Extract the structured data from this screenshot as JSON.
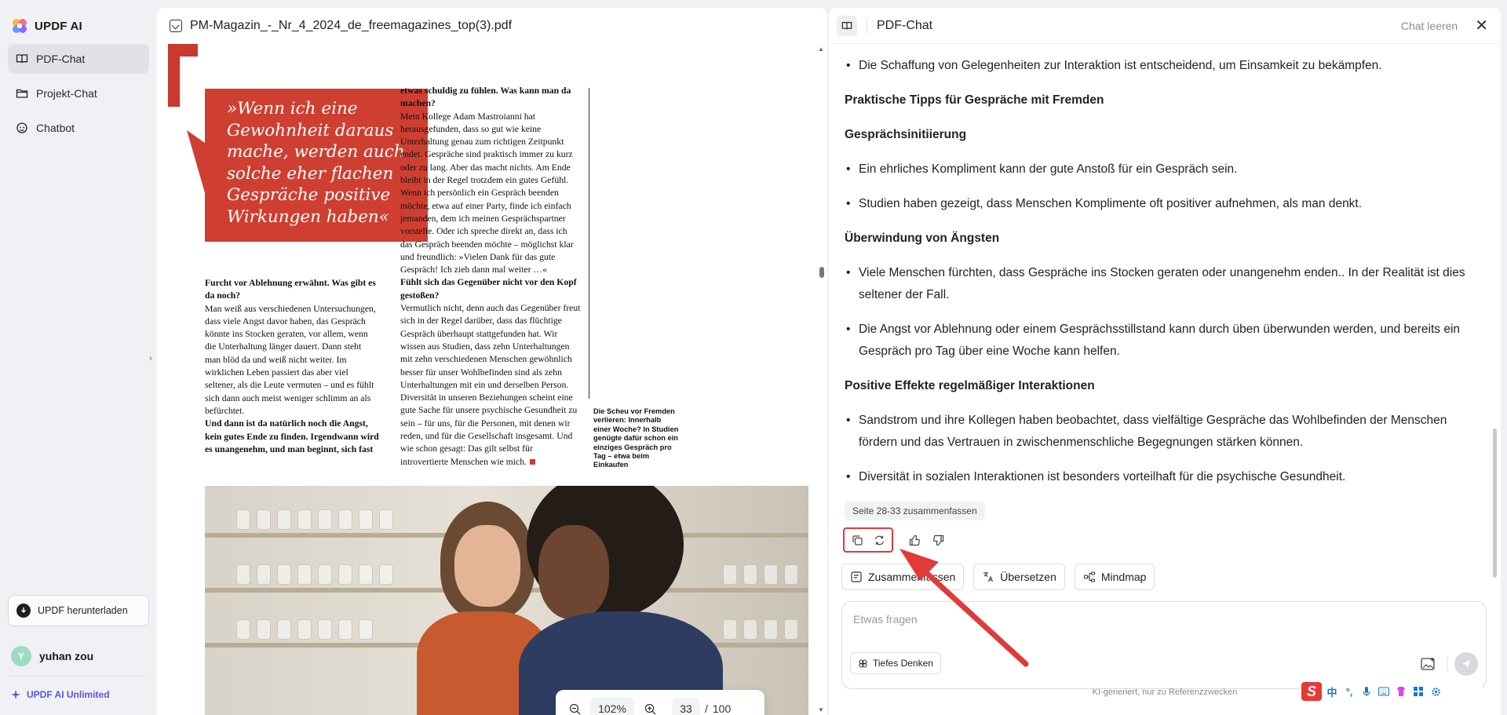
{
  "app": {
    "name": "UPDF AI"
  },
  "sidebar": {
    "items": [
      {
        "label": "PDF-Chat",
        "icon": "book-icon",
        "active": true
      },
      {
        "label": "Projekt-Chat",
        "icon": "folder-icon",
        "active": false
      },
      {
        "label": "Chatbot",
        "icon": "bot-icon",
        "active": false
      }
    ],
    "download_label": "UPDF herunterladen",
    "user": {
      "initial": "Y",
      "name": "yuhan zou"
    },
    "plan_label": "UPDF AI Unlimited"
  },
  "document": {
    "filename": "PM-Magazin_-_Nr_4_2024_de_freemagazines_top(3).pdf",
    "pull_quote": "»Wenn ich eine Gewohnheit daraus mache, werden auch solche eher flachen Gespräche positive Wirkungen haben«",
    "left_column": [
      {
        "bold": true,
        "text": "Furcht vor Ablehnung erwähnt. Was gibt es da noch?"
      },
      {
        "bold": false,
        "text": "Man weiß aus verschiedenen Untersuchungen, dass viele Angst davor haben, das Gespräch könnte ins Stocken geraten, vor allem, wenn die Unterhaltung länger dauert. Dann steht man blöd da und weiß nicht weiter. Im wirklichen Leben passiert das aber viel seltener, als die Leute vermuten – und es fühlt sich dann auch meist weniger schlimm an als befürchtet."
      },
      {
        "bold": true,
        "text": "Und dann ist da natürlich noch die Angst, kein gutes Ende zu finden. Irgendwann wird es unangenehm, und man beginnt, sich fast"
      }
    ],
    "middle_column": [
      {
        "bold": true,
        "text": "etwas schuldig zu fühlen. Was kann man da machen?"
      },
      {
        "bold": false,
        "text": "Mein Kollege Adam Mastroianni hat herausgefunden, dass so gut wie keine Unterhaltung genau zum richtigen Zeitpunkt endet. Gespräche sind praktisch immer zu kurz oder zu lang. Aber das macht nichts. Am Ende bleibt in der Regel trotzdem ein gutes Gefühl. Wenn ich persönlich ein Gespräch beenden möchte, etwa auf einer Party, finde ich einfach jemanden, dem ich meinen Gesprächspartner vorstelle. Oder ich spreche direkt an, dass ich das Gespräch beenden möchte – möglichst klar und freundlich: »Vielen Dank für das gute Gespräch! Ich zieh dann mal weiter …«"
      },
      {
        "bold": true,
        "text": "Fühlt sich das Gegenüber nicht vor den Kopf gestoßen?"
      },
      {
        "bold": false,
        "text": "Vermutlich nicht, denn auch das Gegenüber freut sich in der Regel darüber, dass das flüchtige Gespräch überhaupt stattgefunden hat. Wir wissen aus Studien, dass zehn Unterhaltungen mit zehn verschiedenen Menschen gewöhnlich besser für unser Wohlbefinden sind als zehn Unterhaltungen mit ein und derselben Person. Diversität in unseren Beziehungen scheint eine gute Sache für unsere psychische Gesundheit zu sein – für uns, für die Personen, mit denen wir reden, und für die Gesellschaft insgesamt. Und wie schon gesagt: Das gilt selbst für introvertierte Menschen wie mich."
      }
    ],
    "caption": "Die Scheu vor Fremden verlieren: Innerhalb einer Woche? In Studien genügte dafür schon ein einziges Gespräch pro Tag – etwa beim Einkaufen",
    "zoom": "102%",
    "current_page": "33",
    "page_separator": "/",
    "total_pages": "100"
  },
  "chat": {
    "title": "PDF-Chat",
    "clear_label": "Chat leeren",
    "blocks": [
      {
        "type": "bullet",
        "text": "Die Schaffung von Gelegenheiten zur Interaktion ist entscheidend, um Einsamkeit zu bekämpfen."
      },
      {
        "type": "heading",
        "text": "Praktische Tipps für Gespräche mit Fremden"
      },
      {
        "type": "heading",
        "text": "Gesprächsinitiierung"
      },
      {
        "type": "bullet",
        "text": "Ein ehrliches Kompliment kann der gute Anstoß für ein Gespräch sein."
      },
      {
        "type": "bullet",
        "text": "Studien haben gezeigt, dass Menschen Komplimente oft positiver aufnehmen, als man denkt."
      },
      {
        "type": "heading",
        "text": "Überwindung von Ängsten"
      },
      {
        "type": "bullet",
        "text": "Viele Menschen fürchten, dass Gespräche ins Stocken geraten oder unangenehm enden.. In der Realität ist dies seltener der Fall."
      },
      {
        "type": "bullet",
        "text": "Die Angst vor Ablehnung oder einem Gesprächsstillstand kann durch üben überwunden werden, und bereits ein Gespräch pro Tag über eine Woche kann helfen."
      },
      {
        "type": "heading",
        "text": "Positive Effekte regelmäßiger Interaktionen"
      },
      {
        "type": "bullet",
        "text": "Sandstrom und ihre Kollegen haben beobachtet, dass vielfältige Gespräche das Wohlbefinden der Menschen fördern und das Vertrauen in zwischenmenschliche Begegnungen stärken können."
      },
      {
        "type": "bullet",
        "text": "Diversität in sozialen Interaktionen ist besonders vorteilhaft für die psychische Gesundheit."
      }
    ],
    "summary_chip": "Seite 28-33 zusammenfassen",
    "actions": [
      "copy-icon",
      "regenerate-icon",
      "thumbs-up-icon",
      "thumbs-down-icon"
    ],
    "quick_actions": {
      "summarize": "Zusammenfassen",
      "translate": "Übersetzen",
      "mindmap": "Mindmap"
    },
    "input_placeholder": "Etwas fragen",
    "deep_think_label": "Tiefes Denken",
    "disclaimer": "KI-generiert, nur zu Referenzzwecken"
  },
  "annotation": {
    "color": "#e13a3a"
  },
  "ime": {
    "logo": "S",
    "mode": "中"
  }
}
